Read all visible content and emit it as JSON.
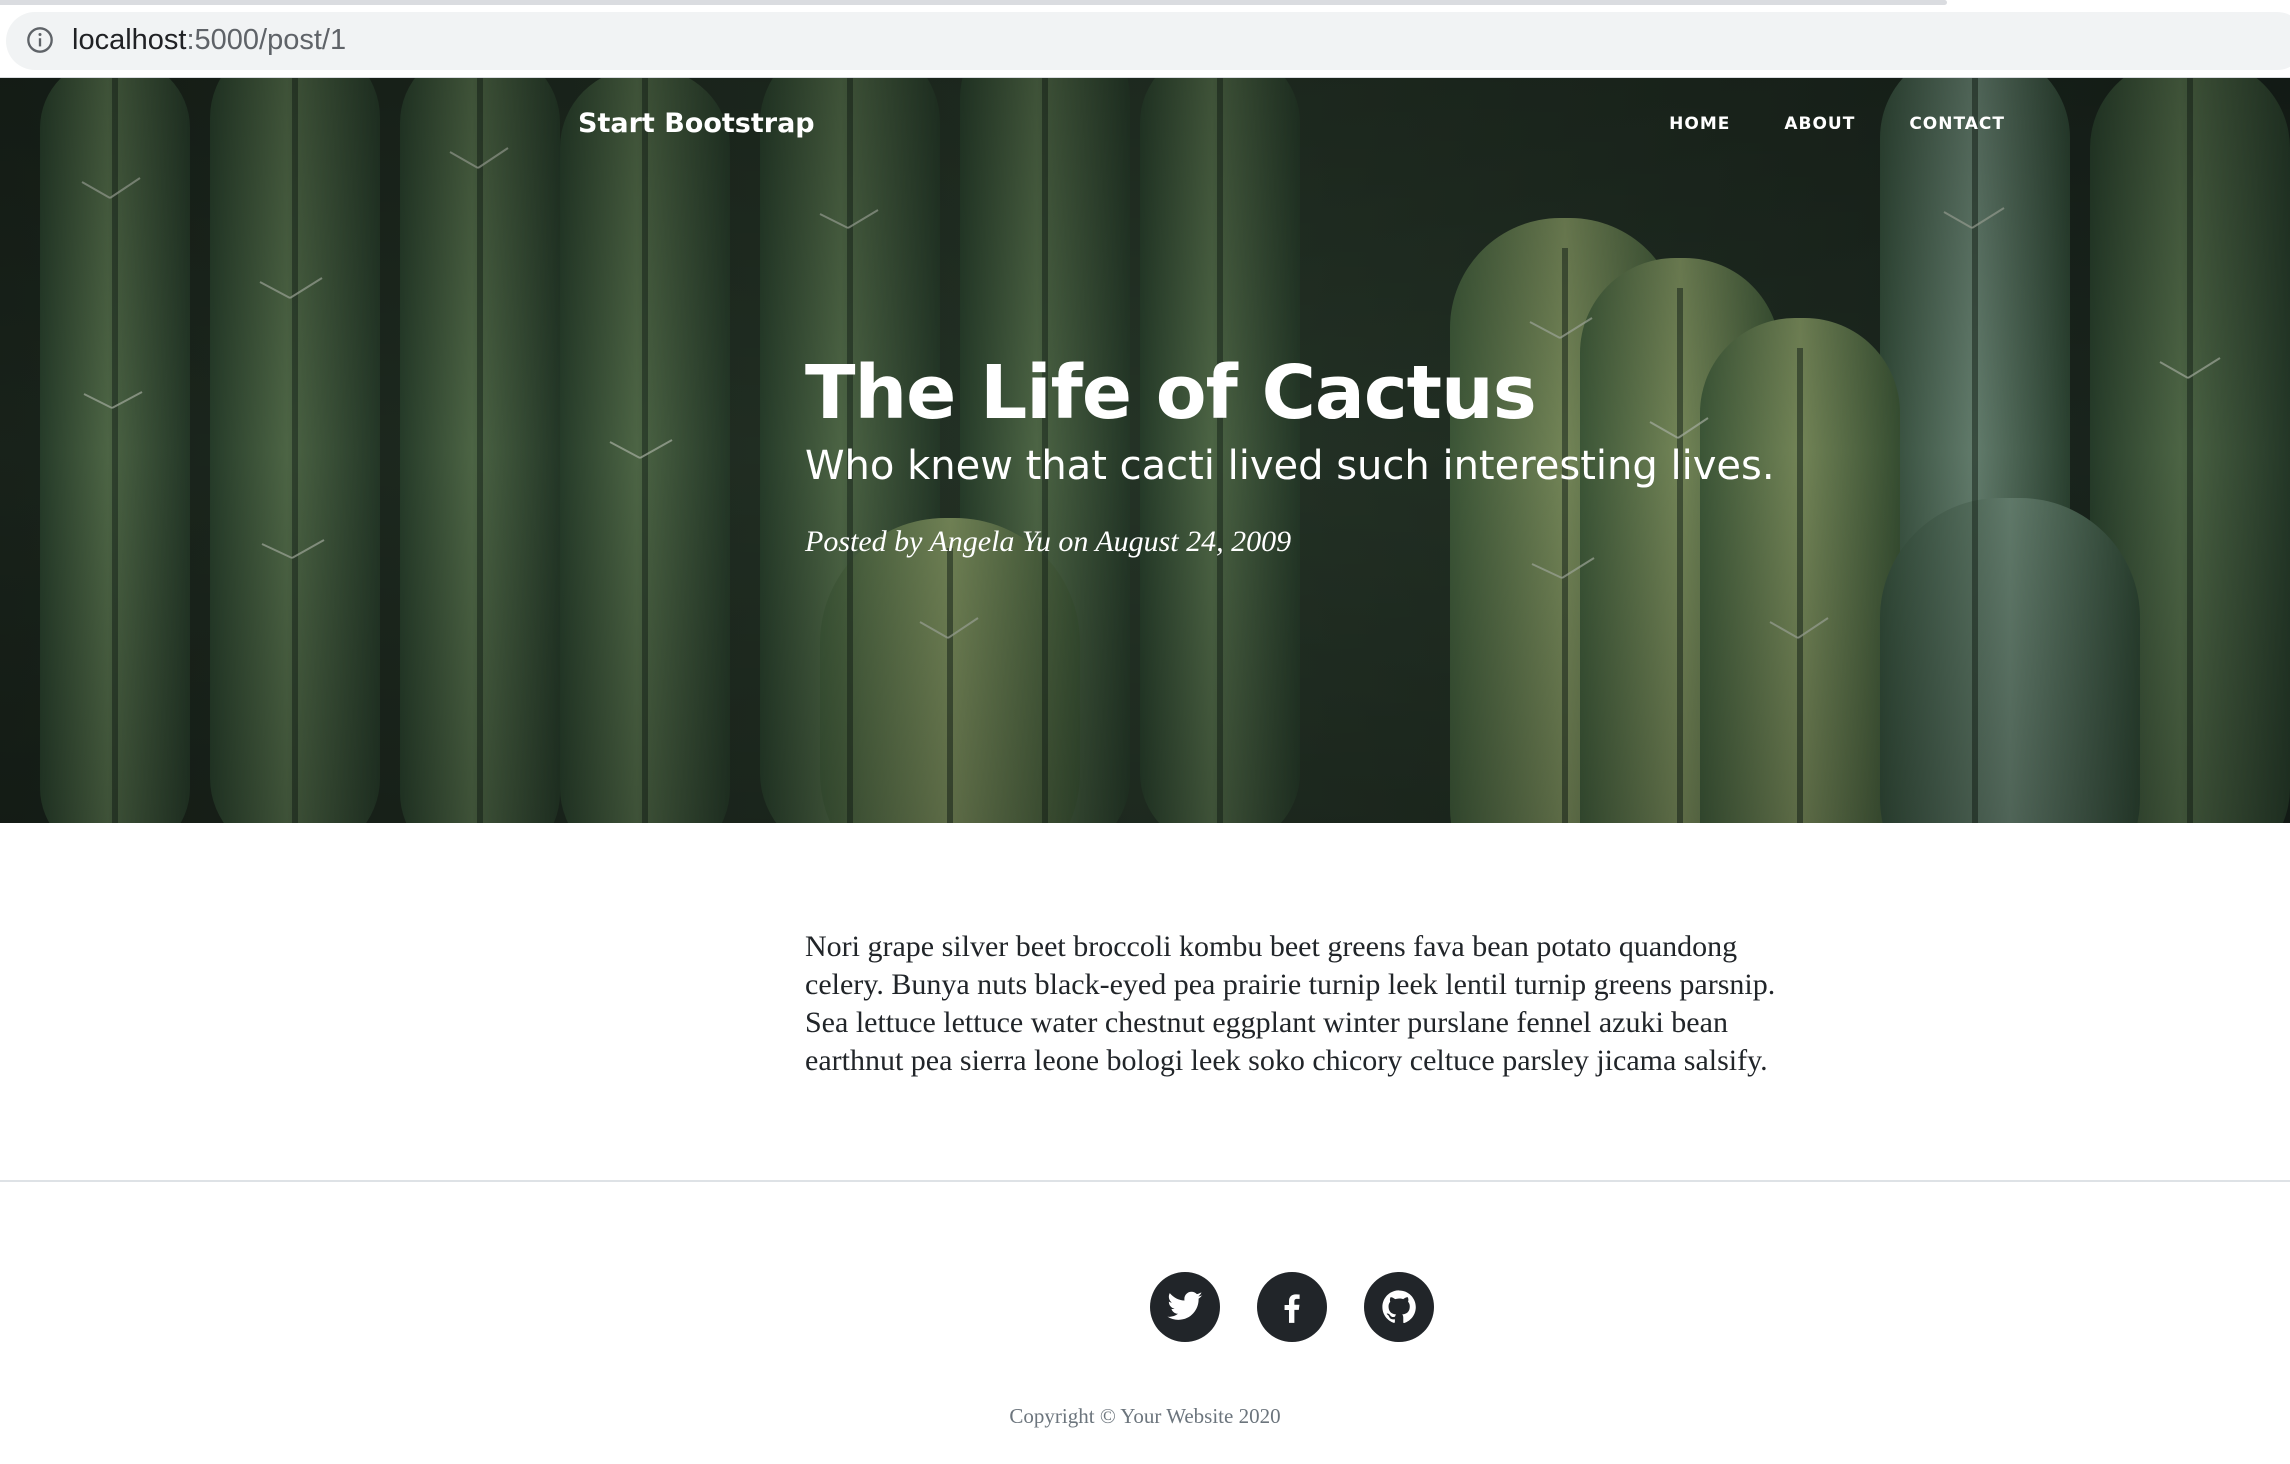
{
  "browser": {
    "url_host": "localhost",
    "url_path": ":5000/post/1",
    "load_progress": 0.85,
    "info_icon": "info-circle-icon"
  },
  "navbar": {
    "brand": "Start Bootstrap",
    "links": [
      "HOME",
      "ABOUT",
      "CONTACT"
    ]
  },
  "post": {
    "title": "The Life of Cactus",
    "subtitle": "Who knew that cacti lived such interesting lives.",
    "meta": "Posted by Angela Yu on August 24, 2009",
    "body": "Nori grape silver beet broccoli kombu beet greens fava bean potato quandong celery. Bunya nuts black-eyed pea prairie turnip leek lentil turnip greens parsnip. Sea lettuce lettuce water chestnut eggplant winter purslane fennel azuki bean earthnut pea sierra leone bologi leek soko chicory celtuce parsley jicama salsify."
  },
  "footer": {
    "social": [
      "twitter-icon",
      "facebook-icon",
      "github-icon"
    ],
    "copyright": "Copyright © Your Website 2020"
  },
  "colors": {
    "footer_icon_bg": "#212529",
    "body_text": "#212529",
    "muted_text": "#6c757d",
    "address_bar_bg": "#f1f3f4"
  }
}
